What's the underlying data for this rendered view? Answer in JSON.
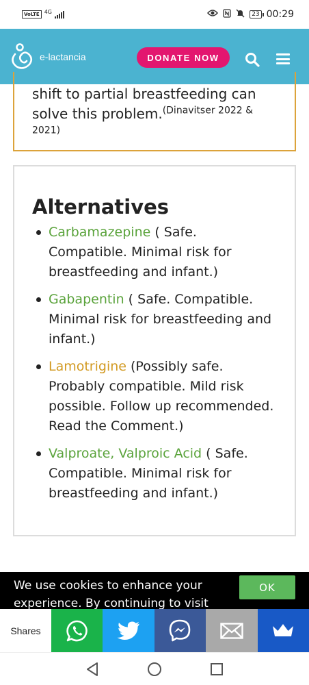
{
  "status_bar": {
    "volte": "VoLTE",
    "network": "4G",
    "battery": "23",
    "time": "00:29",
    "icons": [
      "eye-icon",
      "nfc-icon",
      "mute-icon"
    ]
  },
  "header": {
    "site_name": "e-lactancia",
    "donate_label": "DONATE NOW",
    "background": "#4bb3d0",
    "donate_color": "#e3166f"
  },
  "previous_section": {
    "text": "shift to partial breastfeeding can solve this problem.",
    "citation": "(Dinavitser 2022 & 2021)",
    "border_color": "#dca33a"
  },
  "alternatives": {
    "title": "Alternatives",
    "items": [
      {
        "drug": "Carbamazepine",
        "note": " ( Safe. Compatible. Minimal risk for breastfeeding and infant.)",
        "risk_color": "#5aa33b"
      },
      {
        "drug": "Gabapentin",
        "note": " ( Safe. Compatible. Minimal risk for breastfeeding and infant.)",
        "risk_color": "#5aa33b"
      },
      {
        "drug": "Lamotrigine",
        "note": " (Possibly safe. Probably compatible. Mild risk possible. Follow up recommended. Read the Comment.)",
        "risk_color": "#d29a22"
      },
      {
        "drug": "Valproate, Valproic Acid",
        "note": " ( Safe. Compatible. Minimal risk for breastfeeding and infant.)",
        "risk_color": "#5aa33b"
      }
    ]
  },
  "cookie_bar": {
    "text": "We use cookies to enhance your experience. By continuing to visit this site",
    "ok_label": "OK"
  },
  "share_bar": {
    "label": "Shares",
    "buttons": [
      "whatsapp-icon",
      "twitter-icon",
      "messenger-icon",
      "email-icon",
      "crown-icon"
    ]
  }
}
